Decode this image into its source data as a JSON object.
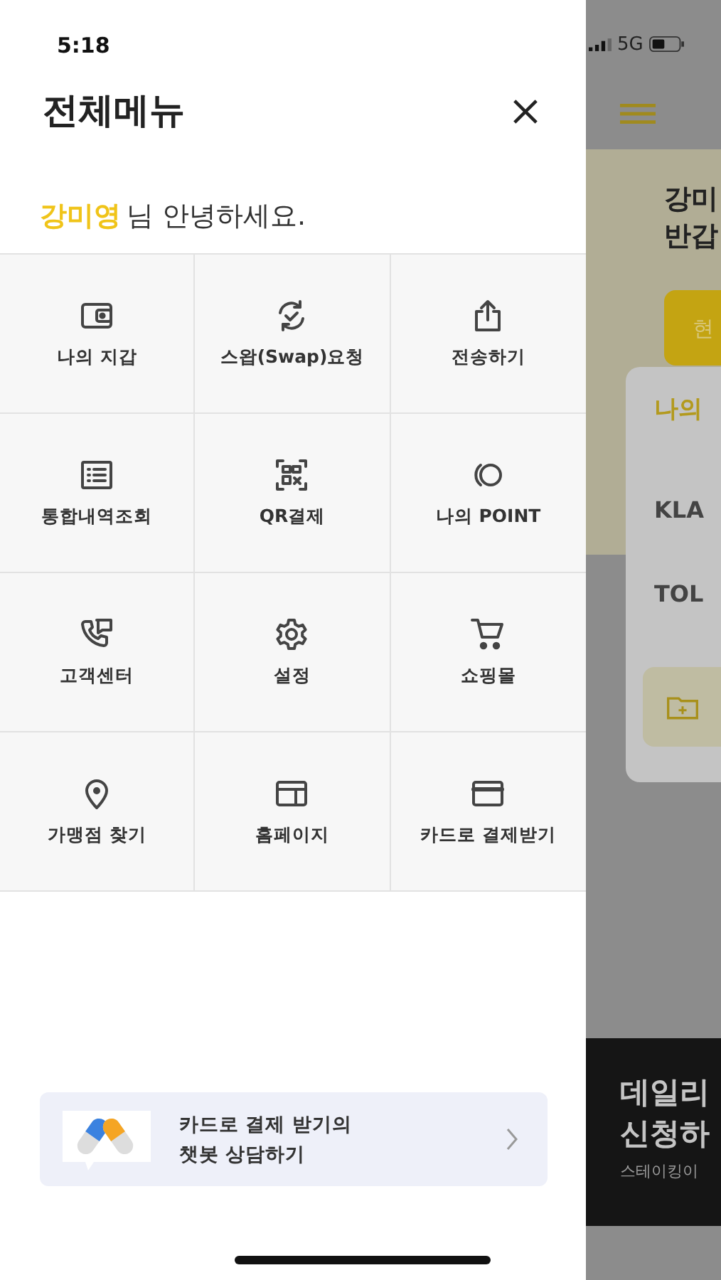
{
  "status_bar": {
    "time": "5:18",
    "network": "5G"
  },
  "drawer": {
    "title": "전체메뉴",
    "greeting": {
      "name": "강미영",
      "text": "님 안녕하세요."
    },
    "menu": [
      {
        "kind": "wallet",
        "label": "나의 지갑"
      },
      {
        "kind": "swap",
        "label": "스왑(Swap)요청"
      },
      {
        "kind": "share",
        "label": "전송하기"
      },
      {
        "kind": "list",
        "label": "통합내역조회"
      },
      {
        "kind": "qr",
        "label": "QR결제"
      },
      {
        "kind": "point",
        "label": "나의 POINT"
      },
      {
        "kind": "phone",
        "label": "고객센터"
      },
      {
        "kind": "gear",
        "label": "설정"
      },
      {
        "kind": "cart",
        "label": "쇼핑몰"
      },
      {
        "kind": "pin",
        "label": "가맹점 찾기"
      },
      {
        "kind": "browser",
        "label": "홈페이지"
      },
      {
        "kind": "card",
        "label": "카드로 결제받기"
      }
    ],
    "chatbot": {
      "lines": [
        "카드로 결제 받기의",
        "챗봇 상담하기"
      ]
    }
  },
  "background_page": {
    "greeting_lines": [
      "강미",
      "반갑"
    ],
    "button": "현",
    "card_title": "나의",
    "assets": [
      "KLA",
      "TOL"
    ],
    "banner": {
      "title_lines": [
        "데일리",
        "신청하"
      ],
      "subtitle": "스테이킹이"
    }
  }
}
